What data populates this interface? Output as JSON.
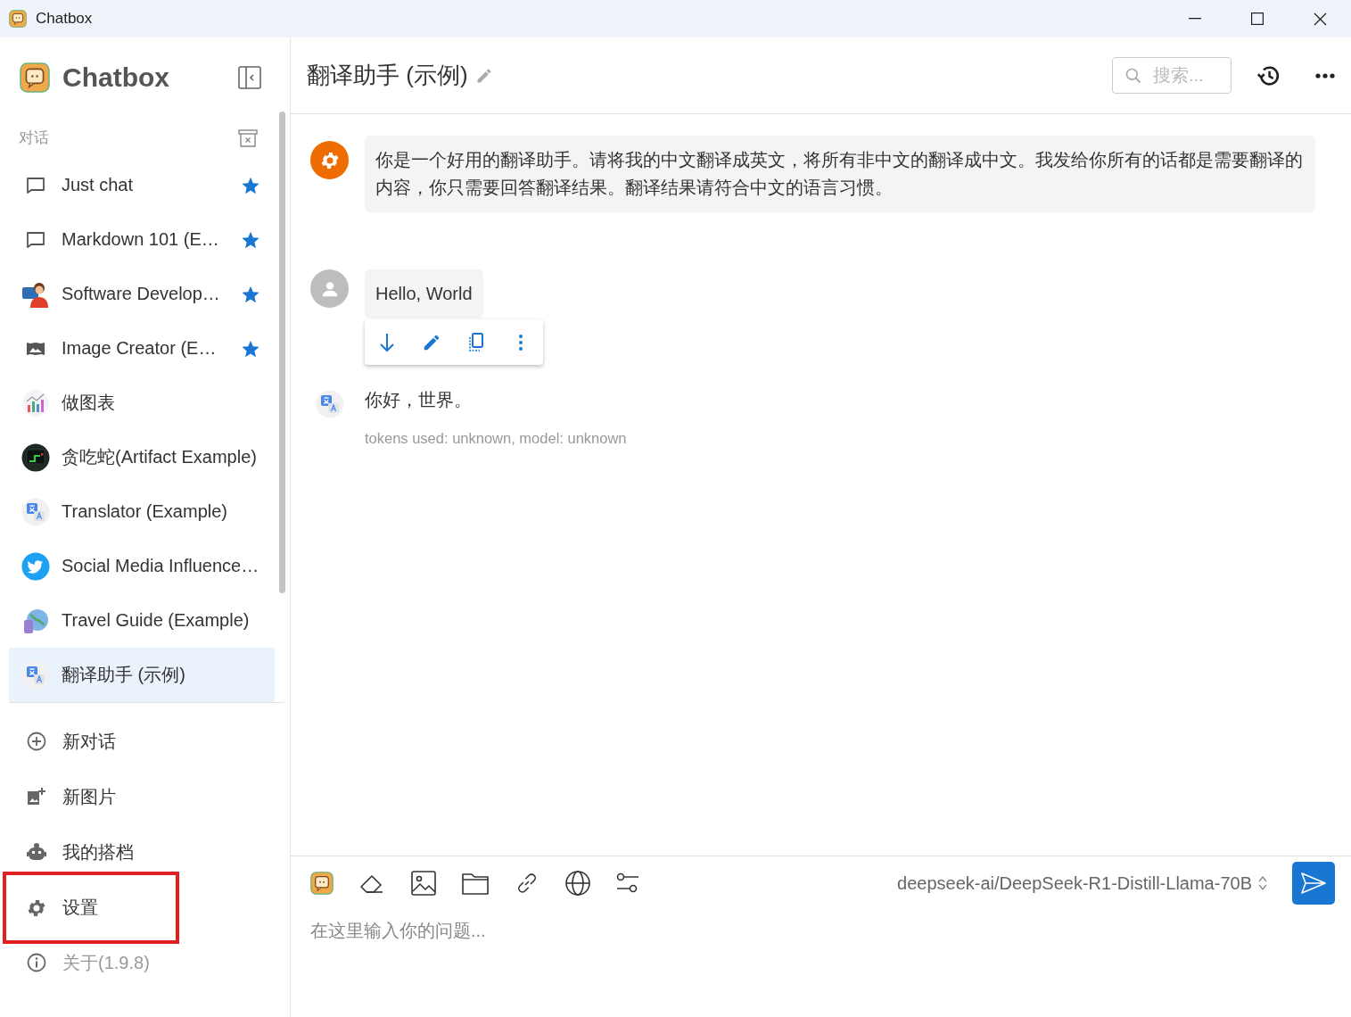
{
  "window": {
    "title": "Chatbox"
  },
  "sidebar": {
    "app_name": "Chatbox",
    "section_label": "对话",
    "conversations": [
      {
        "title": "Just chat",
        "kind": "chat",
        "starred": true,
        "selected": false
      },
      {
        "title": "Markdown 101 (E…",
        "kind": "chat",
        "starred": true,
        "selected": false
      },
      {
        "title": "Software Develop…",
        "kind": "developer",
        "starred": true,
        "selected": false
      },
      {
        "title": "Image Creator (E…",
        "kind": "picture",
        "starred": true,
        "selected": false
      },
      {
        "title": "做图表",
        "kind": "chart",
        "starred": false,
        "selected": false
      },
      {
        "title": "贪吃蛇(Artifact Example)",
        "kind": "snake",
        "starred": false,
        "selected": false
      },
      {
        "title": "Translator (Example)",
        "kind": "translate",
        "starred": false,
        "selected": false
      },
      {
        "title": "Social Media Influence…",
        "kind": "bird",
        "starred": false,
        "selected": false
      },
      {
        "title": "Travel Guide (Example)",
        "kind": "globe",
        "starred": false,
        "selected": false
      },
      {
        "title": "翻译助手 (示例)",
        "kind": "translate",
        "starred": false,
        "selected": true
      }
    ],
    "nav": [
      {
        "label": "新对话",
        "kind": "add",
        "disabled": false,
        "highlighted": false
      },
      {
        "label": "新图片",
        "kind": "image",
        "disabled": false,
        "highlighted": false
      },
      {
        "label": "我的搭档",
        "kind": "robot",
        "disabled": false,
        "highlighted": false
      },
      {
        "label": "设置",
        "kind": "settings",
        "disabled": false,
        "highlighted": true
      },
      {
        "label": "关于(1.9.8)",
        "kind": "info",
        "disabled": true,
        "highlighted": false
      }
    ]
  },
  "header": {
    "title": "翻译助手 (示例)",
    "search_placeholder": "搜索..."
  },
  "messages": [
    {
      "kind": "system",
      "text": "你是一个好用的翻译助手。请将我的中文翻译成英文，将所有非中文的翻译成中文。我发给你所有的话都是需要翻译的内容，你只需要回答翻译结果。翻译结果请符合中文的语言习惯。",
      "actions_shown": false
    },
    {
      "kind": "user",
      "text": "Hello, World",
      "actions_shown": true
    },
    {
      "kind": "assistant",
      "text": "你好，世界。",
      "meta": "tokens used: unknown, model: unknown",
      "actions_shown": false
    }
  ],
  "input": {
    "model": "deepseek-ai/DeepSeek-R1-Distill-Llama-70B",
    "placeholder": "在这里输入你的问题..."
  }
}
